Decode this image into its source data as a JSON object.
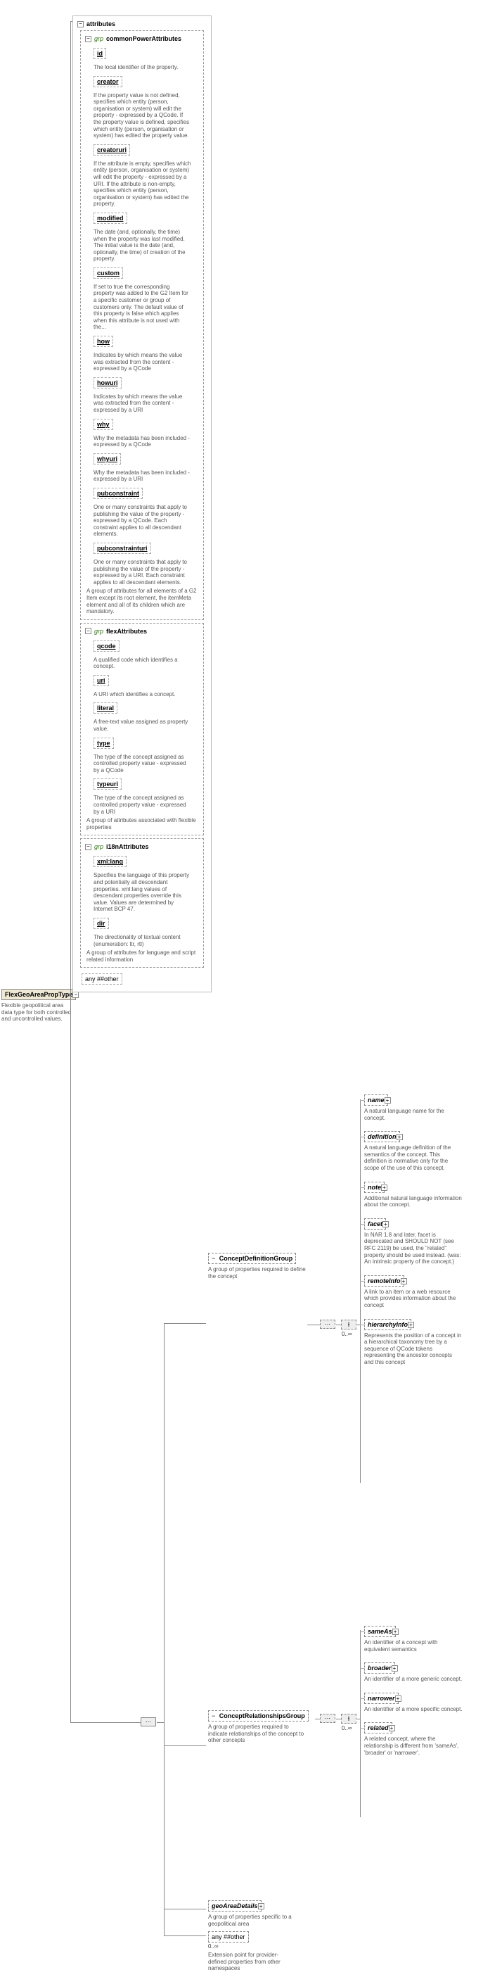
{
  "root": {
    "name": "FlexGeoAreaPropType",
    "desc": "Flexible geopolitical area data type for both controlled and uncontrolled values."
  },
  "groups": {
    "attributes_label": "attributes",
    "common": {
      "grp": "grp",
      "title": "commonPowerAttributes",
      "desc": "A group of attributes for all elements of a G2 Item except its root element, the itemMeta element and all of its children which are mandatory.",
      "attrs": [
        {
          "name": "id",
          "desc": "The local identifier of the property."
        },
        {
          "name": "creator",
          "desc": "If the property value is not defined, specifies which entity (person, organisation or system) will edit the property - expressed by a QCode. If the property value is defined, specifies which entity (person, organisation or system) has edited the property value."
        },
        {
          "name": "creatoruri",
          "desc": "If the attribute is empty, specifies which entity (person, organisation or system) will edit the property - expressed by a URI. If the attribute is non-empty, specifies which entity (person, organisation or system) has edited the property."
        },
        {
          "name": "modified",
          "desc": "The date (and, optionally, the time) when the property was last modified. The initial value is the date (and, optionally, the time) of creation of the property."
        },
        {
          "name": "custom",
          "desc": "If set to true the corresponding property was added to the G2 Item for a specific customer or group of customers only. The default value of this property is false which applies when this attribute is not used with the..."
        },
        {
          "name": "how",
          "desc": "Indicates by which means the value was extracted from the content - expressed by a QCode"
        },
        {
          "name": "howuri",
          "desc": "Indicates by which means the value was extracted from the content - expressed by a URI"
        },
        {
          "name": "why",
          "desc": "Why the metadata has been included - expressed by a QCode"
        },
        {
          "name": "whyuri",
          "desc": "Why the metadata has been included - expressed by a URI"
        },
        {
          "name": "pubconstraint",
          "desc": "One or many constraints that apply to publishing the value of the property - expressed by a QCode. Each constraint applies to all descendant elements."
        },
        {
          "name": "pubconstrainturi",
          "desc": "One or many constraints that apply to publishing the value of the property - expressed by a URI. Each constraint applies to all descendant elements."
        }
      ]
    },
    "flex": {
      "grp": "grp",
      "title": "flexAttributes",
      "desc": "A group of attributes associated with flexible properties",
      "attrs": [
        {
          "name": "qcode",
          "desc": "A qualified code which identifies a concept."
        },
        {
          "name": "uri",
          "desc": "A URI which identifies a concept."
        },
        {
          "name": "literal",
          "desc": "A free-text value assigned as property value."
        },
        {
          "name": "type",
          "desc": "The type of the concept assigned as controlled property value - expressed by a QCode"
        },
        {
          "name": "typeuri",
          "desc": "The type of the concept assigned as controlled property value - expressed by a URI"
        }
      ]
    },
    "i18n": {
      "grp": "grp",
      "title": "i18nAttributes",
      "desc": "A group of attributes for language and script related information",
      "attrs": [
        {
          "name": "xml:lang",
          "desc": "Specifies the language of this property and potentially all descendant properties. xml:lang values of descendant properties override this value. Values are determined by Internet BCP 47."
        },
        {
          "name": "dir",
          "desc": "The directionality of textual content (enumeration: ltr, rtl)"
        }
      ]
    },
    "any_other": "any ##other"
  },
  "concept_def": {
    "title": "ConceptDefinitionGroup",
    "desc": "A group of properties required to define the concept",
    "occurs": "0..∞",
    "children": [
      {
        "name": "name",
        "desc": "A natural language name for the concept."
      },
      {
        "name": "definition",
        "desc": "A natural language definition of the semantics of the concept. This definition is normative only for the scope of the use of this concept."
      },
      {
        "name": "note",
        "desc": "Additional natural language information about the concept."
      },
      {
        "name": "facet",
        "desc": "In NAR 1.8 and later, facet is deprecated and SHOULD NOT (see RFC 2119) be used, the \"related\" property should be used instead. (was: An intrinsic property of the concept.)"
      },
      {
        "name": "remoteInfo",
        "desc": "A link to an item or a web resource which provides information about the concept"
      },
      {
        "name": "hierarchyInfo",
        "desc": "Represents the position of a concept in a hierarchical taxonomy tree by a sequence of QCode tokens representing the ancestor concepts and this concept"
      }
    ]
  },
  "concept_rel": {
    "title": "ConceptRelationshipsGroup",
    "desc": "A group of properties required to indicate relationships of the concept to other concepts",
    "occurs": "0..∞",
    "children": [
      {
        "name": "sameAs",
        "desc": "An identifier of a concept with equivalent semantics"
      },
      {
        "name": "broader",
        "desc": "An identifier of a more generic concept."
      },
      {
        "name": "narrower",
        "desc": "An identifier of a more specific concept."
      },
      {
        "name": "related",
        "desc": "A related concept, where the relationship is different from 'sameAs', 'broader' or 'narrower'."
      }
    ]
  },
  "geo": {
    "title": "geoAreaDetails",
    "desc": "A group of properties specific to a geopolitical area",
    "any_other": "any ##other",
    "any_occurs": "0..∞",
    "any_desc": "Extension point for provider-defined properties from other namespaces"
  }
}
